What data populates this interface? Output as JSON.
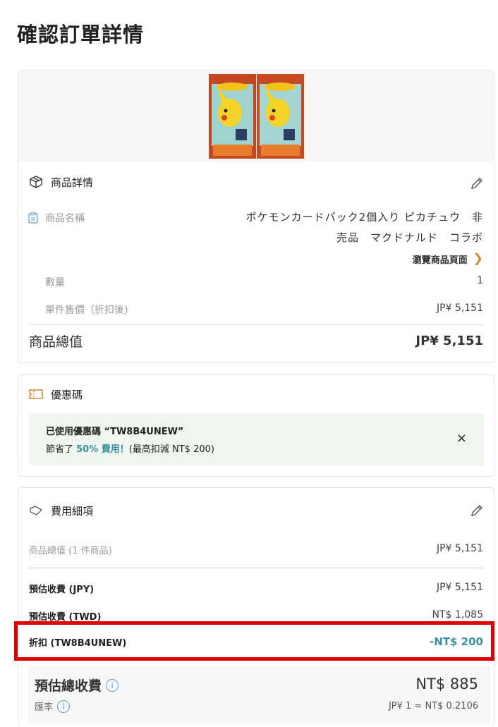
{
  "page": {
    "title": "確認訂單詳情"
  },
  "product": {
    "section_title": "商品詳情",
    "image_alt": "ポケモンカードパック",
    "name_label": "商品名稱",
    "name_value": "ポケモンカードパック2個入り ピカチュウ　非売品　マクドナルド　コラボ",
    "view_link": "瀏覽商品頁面",
    "quantity_label": "數量",
    "quantity_value": "1",
    "unit_price_label": "單件售價（折扣後)",
    "unit_price_value": "JP¥ 5,151",
    "total_label": "商品總值",
    "total_value": "JP¥ 5,151"
  },
  "coupon": {
    "section_title": "優惠碼",
    "line1": "已使用優惠碼 “TW8B4UNEW”",
    "line2_prefix": "節省了 ",
    "line2_highlight": "50% 費用！",
    "line2_suffix": "(最高扣減 NT$ 200)",
    "close": "×"
  },
  "fees": {
    "section_title": "費用細項",
    "subtotal_label": "商品總值 (1 件商品)",
    "subtotal_value": "JP¥ 5,151",
    "est_jpy_label": "預估收費 (JPY)",
    "est_jpy_value": "JP¥ 5,151",
    "est_twd_label": "預估收費 (TWD)",
    "est_twd_value": "NT$ 1,085",
    "discount_label": "折扣 (TW8B4UNEW)",
    "discount_value": "-NT$ 200",
    "grand_label": "預估總收費",
    "grand_value": "NT$ 885",
    "rate_label": "匯率",
    "rate_value": "JP¥ 1 ≈ NT$ 0.2106"
  },
  "colors": {
    "accent": "#d8862b",
    "teal": "#3a8fa0",
    "highlight": "#e00000",
    "coupon_bg": "#eef6ee"
  }
}
